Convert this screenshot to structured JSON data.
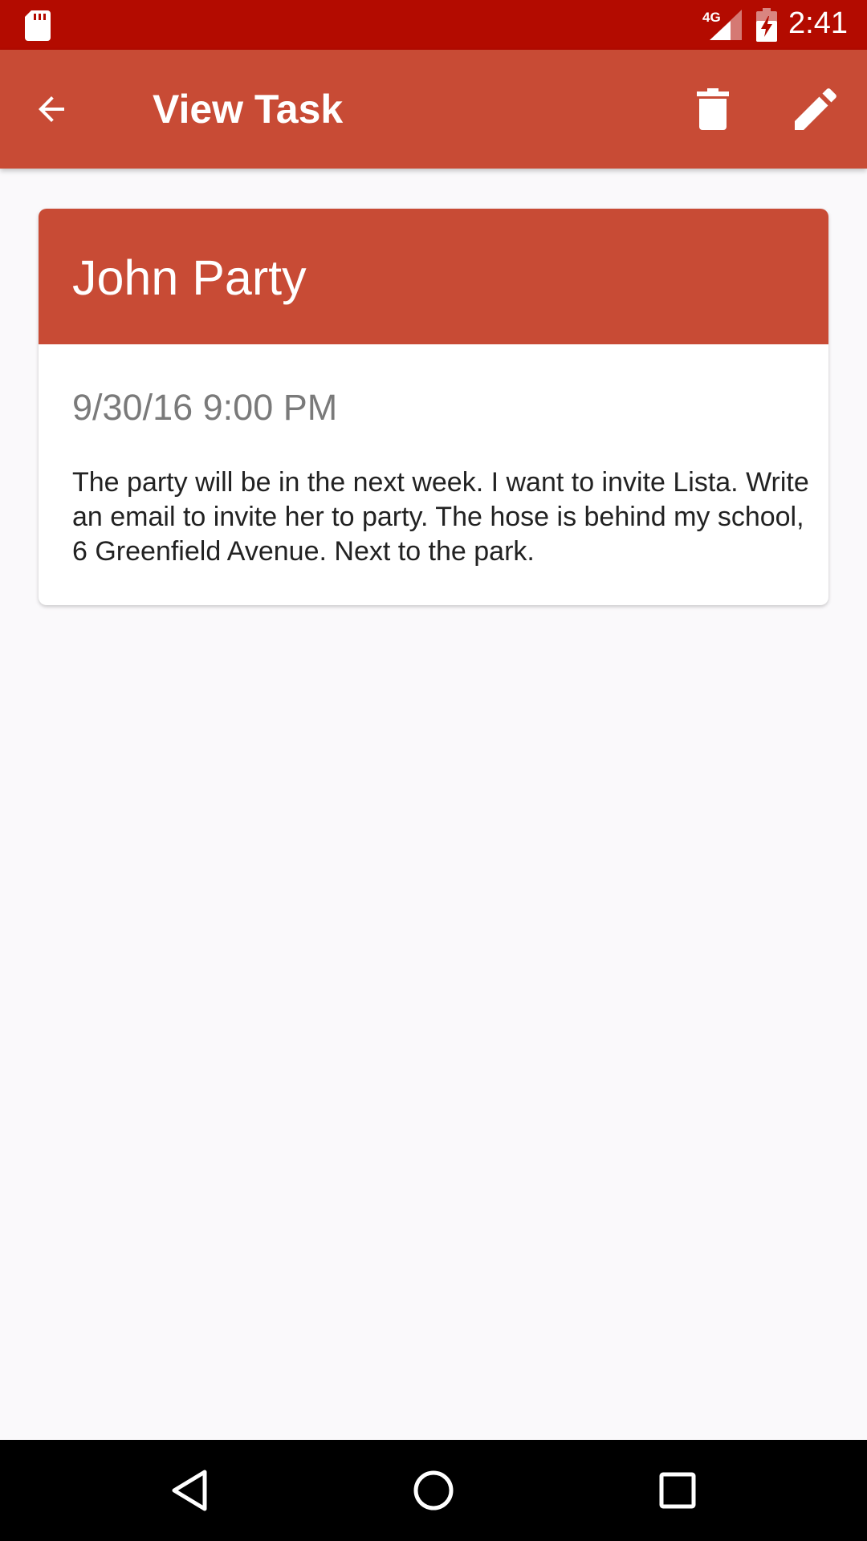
{
  "status_bar": {
    "network_type": "4G",
    "time": "2:41",
    "icons": [
      "sd-card-icon",
      "cell-signal-icon",
      "battery-charging-icon"
    ]
  },
  "app_bar": {
    "title": "View Task",
    "back_icon": "arrow-back-icon",
    "delete_icon": "trash-icon",
    "edit_icon": "pencil-icon"
  },
  "task": {
    "title": "John Party",
    "datetime": "9/30/16 9:00 PM",
    "description": "The party will be in the next week. I want to invite Lista. Write an email to invite her to party. The hose is behind my school, 6 Greenfield Avenue. Next to the park."
  },
  "nav_bar": {
    "icons": [
      "back-triangle-icon",
      "home-circle-icon",
      "recents-square-icon"
    ]
  },
  "colors": {
    "status_bar": "#b30b00",
    "accent": "#c84b35",
    "background": "#faf9fb",
    "date_text": "#7a7a7a",
    "body_text": "#222222"
  }
}
